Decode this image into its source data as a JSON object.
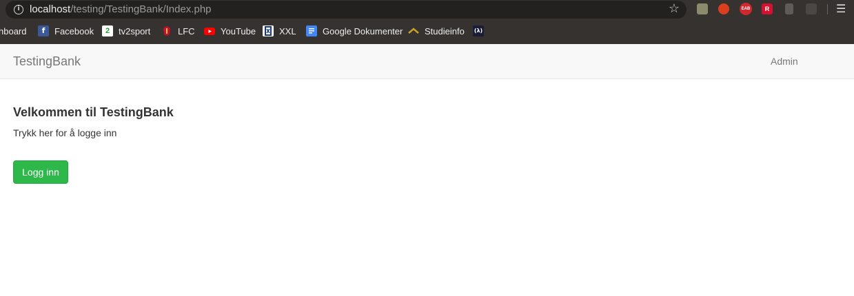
{
  "browser": {
    "url_host": "localhost",
    "url_path": "/testing/TestingBank/Index.php",
    "extensions": {
      "e3_label": "EAB",
      "e4_label": "R"
    },
    "bookmarks": [
      {
        "label": "hboard",
        "icon": "dashboard-icon"
      },
      {
        "label": "Facebook",
        "icon": "facebook-icon",
        "glyph": "f",
        "color": "#3b5998"
      },
      {
        "label": "tv2sport",
        "icon": "tv2sport-icon",
        "glyph": "2",
        "color": "#ffffff"
      },
      {
        "label": "LFC",
        "icon": "lfc-icon",
        "color": "#c8102e"
      },
      {
        "label": "YouTube",
        "icon": "youtube-icon",
        "color": "#ff0000"
      },
      {
        "label": "XXL",
        "icon": "xxl-icon",
        "color": "#ffffff"
      },
      {
        "label": "Google Dokumenter",
        "icon": "google-docs-icon",
        "color": "#4285f4"
      },
      {
        "label": "Studieinfo",
        "icon": "studieinfo-icon",
        "color": "#c9a227"
      },
      {
        "label": "",
        "icon": "lambda-icon",
        "glyph": "(λ)",
        "color": "#1b1b3a"
      }
    ]
  },
  "navbar": {
    "brand": "TestingBank",
    "admin_link": "Admin"
  },
  "main": {
    "title": "Velkommen til TestingBank",
    "text": "Trykk her for å logge inn",
    "login_button": "Logg inn"
  },
  "colors": {
    "button_green": "#2eb84a",
    "navbar_bg": "#f8f8f8",
    "chrome_bg": "#353230"
  }
}
